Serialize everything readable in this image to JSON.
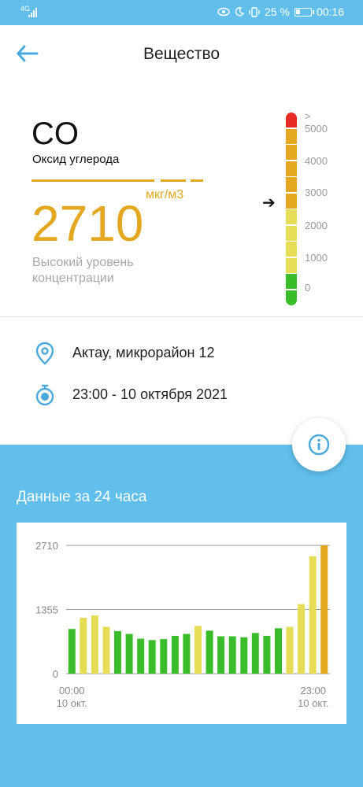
{
  "status_bar": {
    "network": "4G",
    "battery_percent": "25 %",
    "time": "00:16"
  },
  "app_bar": {
    "title": "Вещество"
  },
  "substance": {
    "formula": "CO",
    "name": "Оксид углерода",
    "value": "2710",
    "units": "мкг/м3",
    "level_text": "Высокий уровень концентрации"
  },
  "scale": {
    "colors": [
      "#e52b23",
      "#e3a820",
      "#e3a820",
      "#e3a820",
      "#e3a820",
      "#e3a820",
      "#e6dc56",
      "#e6dc56",
      "#e6dc56",
      "#e6dc56",
      "#3bbd2b",
      "#3bbd2b"
    ],
    "labels": [
      ">",
      "5000",
      "4000",
      "3000",
      "2000",
      "1000",
      "0"
    ],
    "pointer_icon": "arrow-right-icon"
  },
  "location": {
    "place": "Актау, микрорайон 12",
    "datetime": "23:00 - 10 октября 2021"
  },
  "section_title": "Данные за 24 часа",
  "chart_data": {
    "type": "bar",
    "title": "Данные за 24 часа",
    "y_ticks": [
      "2710",
      "1355",
      "0"
    ],
    "ylim": [
      0,
      2710
    ],
    "x_labels": [
      {
        "time": "00:00",
        "date": "10 окт."
      },
      {
        "time": "23:00",
        "date": "10 окт."
      }
    ],
    "values": [
      945,
      1180,
      1230,
      990,
      900,
      840,
      740,
      710,
      730,
      800,
      840,
      1010,
      910,
      790,
      790,
      770,
      860,
      800,
      960,
      990,
      1470,
      2480,
      2710
    ],
    "colors": [
      "#3bbd2b",
      "#e6dc56",
      "#e6dc56",
      "#e6dc56",
      "#3bbd2b",
      "#3bbd2b",
      "#3bbd2b",
      "#3bbd2b",
      "#3bbd2b",
      "#3bbd2b",
      "#3bbd2b",
      "#e6dc56",
      "#3bbd2b",
      "#3bbd2b",
      "#3bbd2b",
      "#3bbd2b",
      "#3bbd2b",
      "#3bbd2b",
      "#3bbd2b",
      "#e6dc56",
      "#e6dc56",
      "#e6dc56",
      "#e3a820"
    ],
    "grid": true
  }
}
